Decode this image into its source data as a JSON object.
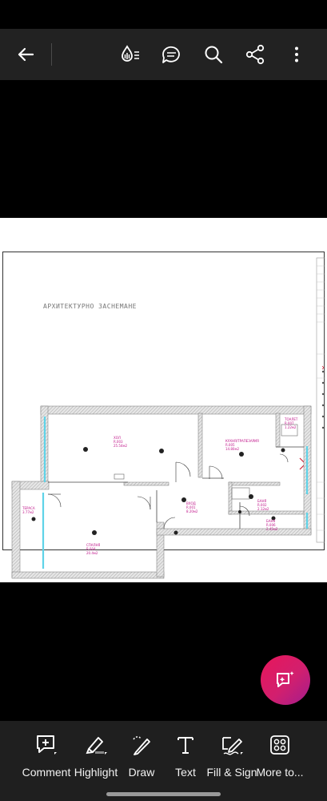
{
  "toolbar": {
    "back_icon": "arrow-left-icon",
    "liquid_mode_icon": "liquid-mode-icon",
    "comments_icon": "comments-list-icon",
    "search_icon": "search-icon",
    "share_icon": "share-icon",
    "more_icon": "more-vertical-icon"
  },
  "document": {
    "plan_title": "АРХИТЕКТУРНО ЗАСНЕМАНЕ",
    "rooms": [
      {
        "name": "ХОЛ",
        "code": "R.003",
        "area": "25.54м2"
      },
      {
        "name": "КУХНЯ/ТРАПЕЗАРИЯ",
        "code": "R.005",
        "area": "14.80м2"
      },
      {
        "name": "ВХОД",
        "code": "R.001",
        "area": "8.20м2"
      },
      {
        "name": "СПАЛНЯ",
        "code": "R.004",
        "area": "20.4м2"
      },
      {
        "name": "БАНЯ",
        "code": "R.002",
        "area": "2.12м2"
      },
      {
        "name": "БАНЯ",
        "code": "R.006",
        "area": "2.45м2"
      },
      {
        "name": "ТОАЛЕТ",
        "code": "R.007",
        "area": "1.22м2"
      },
      {
        "name": "ТЕРАСА",
        "code": "R.008",
        "area": "3.77м2"
      }
    ]
  },
  "fab": {
    "icon": "ai-assistant-chat-icon"
  },
  "bottom_bar": {
    "items": [
      {
        "label": "Comment",
        "icon": "comment-add-icon"
      },
      {
        "label": "Highlight",
        "icon": "highlighter-icon"
      },
      {
        "label": "Draw",
        "icon": "pencil-draw-icon"
      },
      {
        "label": "Text",
        "icon": "text-t-icon"
      },
      {
        "label": "Fill & Sign",
        "icon": "fill-sign-icon"
      },
      {
        "label": "More to...",
        "icon": "more-tools-grid-icon"
      }
    ]
  },
  "colors": {
    "toolbar_bg": "#222222",
    "bottom_bar_bg": "#1f1f1f",
    "fab_gradient_start": "#e8165a",
    "fab_gradient_end": "#a21e8e",
    "room_label": "#c0158a",
    "window_cyan": "#5fd3e8"
  }
}
